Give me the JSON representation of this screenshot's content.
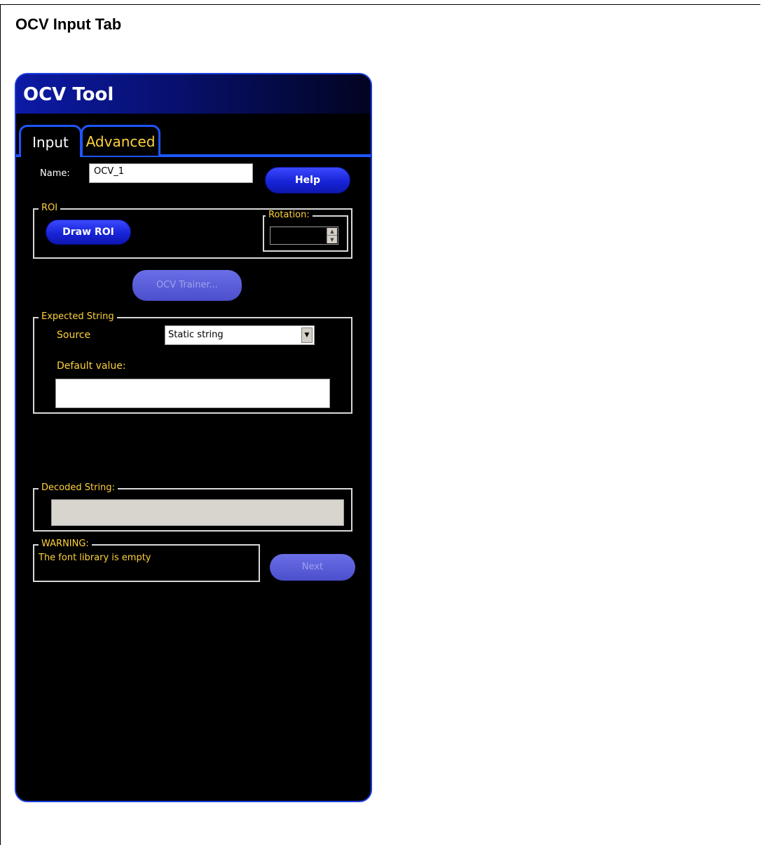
{
  "doc": {
    "title": "OCV Input Tab"
  },
  "window": {
    "title": "OCV Tool"
  },
  "tabs": [
    {
      "label": "Input",
      "selected": true
    },
    {
      "label": "Advanced",
      "selected": false
    }
  ],
  "name_field": {
    "label": "Name:",
    "value": "OCV_1"
  },
  "buttons": {
    "help": "Help",
    "draw_roi": "Draw ROI",
    "ocv_trainer": "OCV Trainer...",
    "next": "Next"
  },
  "roi_group": {
    "legend": "ROI",
    "rotation_legend": "Rotation:",
    "rotation_value": ""
  },
  "expected_string": {
    "legend": "Expected String",
    "source_label": "Source",
    "source_value": "Static string",
    "default_label": "Default value:",
    "default_value": ""
  },
  "decoded_string": {
    "legend": "Decoded String:",
    "value": ""
  },
  "warning": {
    "legend": "WARNING:",
    "message": "The font library is empty"
  },
  "colors": {
    "accent_blue": "#1e56ff",
    "label_yellow": "#ffd23a",
    "background": "#000000"
  }
}
